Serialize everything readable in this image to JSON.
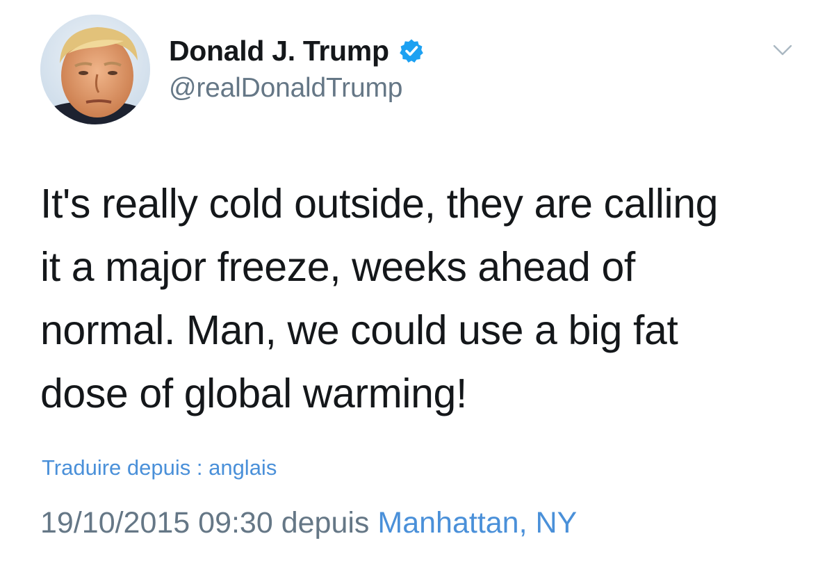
{
  "user": {
    "display_name": "Donald J. Trump",
    "handle": "@realDonaldTrump",
    "verified": true
  },
  "tweet": {
    "lines": [
      "It's really cold outside, they are calling",
      "it a major freeze, weeks ahead of",
      "normal. Man, we could use a big fat",
      "dose of global warming!"
    ]
  },
  "translate": {
    "label": "Traduire depuis : anglais"
  },
  "meta": {
    "timestamp": "19/10/2015 09:30",
    "via_word": "depuis",
    "location": "Manhattan, NY"
  },
  "icons": {
    "verified": "verified-badge-icon",
    "menu": "chevron-down-icon"
  },
  "colors": {
    "link": "#4a90d9",
    "secondary": "#657786",
    "text": "#14171a",
    "verified": "#1da1f2"
  }
}
